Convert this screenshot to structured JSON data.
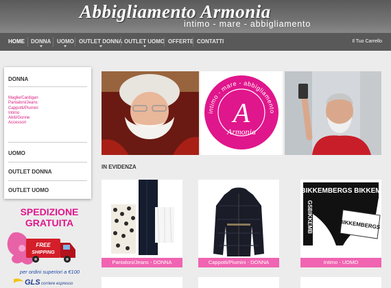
{
  "header": {
    "title": "Abbigliamento Armonia",
    "subtitle": "intimo - mare - abbigliamento"
  },
  "nav": {
    "items": [
      {
        "label": "HOME",
        "active": true,
        "has_dropdown": false
      },
      {
        "label": "DONNA",
        "active": false,
        "has_dropdown": true
      },
      {
        "label": "UOMO",
        "active": false,
        "has_dropdown": true
      },
      {
        "label": "OUTLET DONNA",
        "active": false,
        "has_dropdown": true
      },
      {
        "label": "OUTLET UOMO",
        "active": false,
        "has_dropdown": true
      },
      {
        "label": "OFFERTE",
        "active": false,
        "has_dropdown": false
      },
      {
        "label": "CONTATTI",
        "active": false,
        "has_dropdown": false
      }
    ],
    "cart_label": "Il Tuo Carrello"
  },
  "sidebar": {
    "donna": {
      "label": "DONNA",
      "items": [
        "Maglie/Cardigan",
        "Pantaloni/Jeans",
        "Cappotti/Piumini",
        "Intimo",
        "Abiti/Gonne",
        "Accessori"
      ]
    },
    "uomo": "UOMO",
    "outlet_donna": "OUTLET DONNA",
    "outlet_uomo": "OUTLET UOMO"
  },
  "promo": {
    "line1": "SPEDIZIONE",
    "line2": "GRATUITA",
    "truck_line1": "FREE",
    "truck_line2": "SHIPPING",
    "note": "per ordini superiori a €100",
    "courier": "GLS",
    "courier_sub": "corriere espresso"
  },
  "badge": {
    "top_text": "intimo - mare - abbigliamento",
    "letter": "A",
    "name": "Armonia"
  },
  "section_title": "IN EVIDENZA",
  "products": [
    {
      "label": "Pantaloni/Jeans - DONNA"
    },
    {
      "label": "Cappotti/Piumini - DONNA"
    },
    {
      "label": "Intimo - UOMO"
    }
  ],
  "brand_print": {
    "top": "BIKKEMBERGS BIKKEM",
    "side": "GSBIKKEMB",
    "front": "BIKKEMBERGS"
  },
  "colors": {
    "accent": "#e0168c",
    "label_pink": "#f064b1",
    "nav_bg": "#595959"
  }
}
